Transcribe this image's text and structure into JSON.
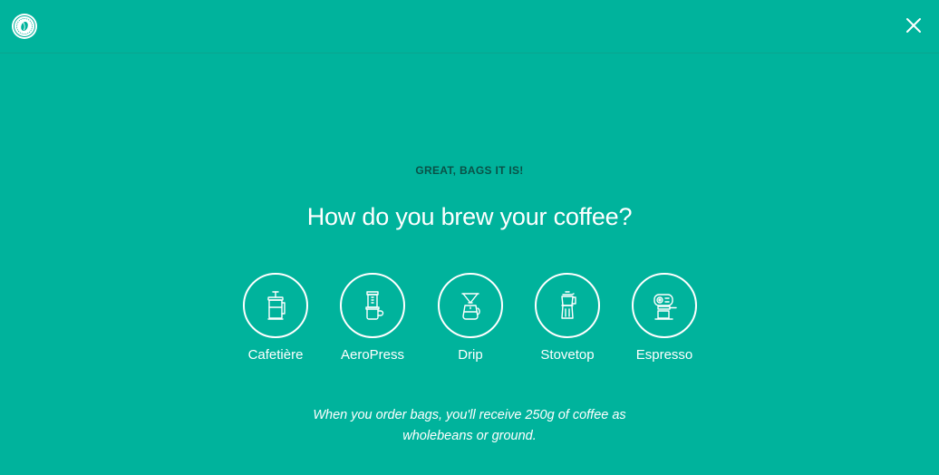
{
  "header": {
    "logo_icon": "coffee-bean-seal-logo",
    "close_icon": "close-x"
  },
  "main": {
    "eyebrow": "GREAT, BAGS IT IS!",
    "question": "How do you brew your coffee?",
    "methods": [
      {
        "label": "Cafetière",
        "icon": "french-press-icon"
      },
      {
        "label": "AeroPress",
        "icon": "aeropress-icon"
      },
      {
        "label": "Drip",
        "icon": "drip-pour-over-icon"
      },
      {
        "label": "Stovetop",
        "icon": "moka-pot-icon"
      },
      {
        "label": "Espresso",
        "icon": "espresso-machine-icon"
      }
    ],
    "note": "When you order bags, you'll receive 250g of coffee as wholebeans or ground."
  },
  "colors": {
    "background": "#00b39c",
    "eyebrow": "#0a5147",
    "text": "#ffffff"
  }
}
